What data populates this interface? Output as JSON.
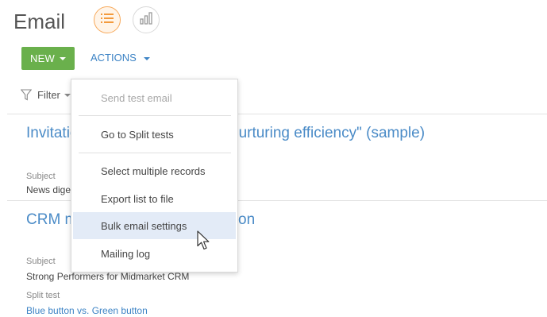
{
  "header": {
    "title": "Email",
    "views": [
      {
        "icon": "list-view-icon",
        "active": true
      },
      {
        "icon": "chart-view-icon",
        "active": false
      }
    ]
  },
  "toolbar": {
    "new_label": "NEW",
    "actions_label": "ACTIONS"
  },
  "filter": {
    "label": "Filter"
  },
  "actions_menu": {
    "items": [
      {
        "label": "Send test email",
        "disabled": true
      },
      {
        "label": "Go to Split tests"
      },
      {
        "label": "Select multiple records"
      },
      {
        "label": "Export list to file"
      },
      {
        "label": "Bulk email settings",
        "highlighted": true
      },
      {
        "label": "Mailing log"
      }
    ]
  },
  "records": [
    {
      "title_left": "Invitatio",
      "title_right": "nurturing efficiency\" (sample)",
      "fields": [
        {
          "caption": "Subject",
          "value": "News dige"
        }
      ]
    },
    {
      "title_left": "CRM m",
      "title_right": "on",
      "fields": [
        {
          "caption": "Subject",
          "value": "Strong Performers for Midmarket CRM"
        },
        {
          "caption": "Split test",
          "value": "Blue button vs. Green button"
        }
      ]
    }
  ],
  "colors": {
    "new_button": "#6ab04c",
    "link": "#3c83c5",
    "record_title": "#4a8bc7",
    "active_view_border": "#f7a95a",
    "menu_hover": "#e3ebf7"
  }
}
